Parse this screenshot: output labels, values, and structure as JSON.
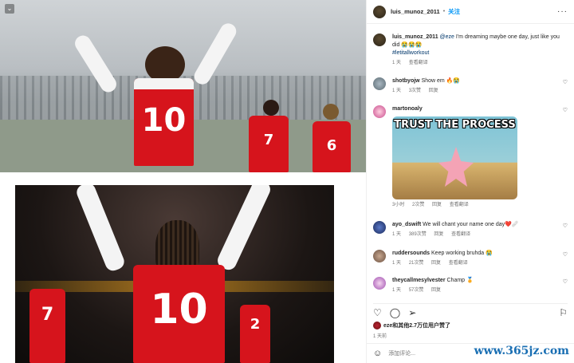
{
  "post": {
    "author": "luis_munoz_2011",
    "separator": "•",
    "follow_label": "关注",
    "more_label": "···",
    "caption_mention": "@eze",
    "caption_text": " I'm dreaming maybe one day, just like you did 😭😭😭",
    "hashtag": "#letitallworkout",
    "caption_time": "1 天",
    "caption_translate": "查看翻译"
  },
  "comments": [
    {
      "user": "shotbyojw",
      "text": "Show em 🔥😭",
      "time": "1 天",
      "likes": "3次赞",
      "reply": "回复"
    },
    {
      "user": "martonoaly",
      "text": "",
      "time": "3小时",
      "likes": "2次赞",
      "reply": "回复",
      "translate": "查看翻译",
      "meme_text": "TRUST THE PROCESS"
    },
    {
      "user": "ayo_dswift",
      "text": "We will chant your name one day❤️🩹",
      "time": "1 天",
      "likes": "389次赞",
      "reply": "回复",
      "translate": "查看翻译"
    },
    {
      "user": "ruddersounds",
      "text": "Keep working bruhda 😭",
      "time": "1 天",
      "likes": "21次赞",
      "reply": "回复",
      "translate": "查看翻译"
    },
    {
      "user": "theycallmesylvester",
      "text": "Champ 🏅",
      "time": "1 天",
      "likes": "57次赞",
      "reply": "回复"
    }
  ],
  "actions": {
    "like_icon": "heart-icon",
    "comment_icon": "comment-icon",
    "share_icon": "share-icon",
    "save_icon": "bookmark-icon"
  },
  "likes_text": "eze和其他2.7万位用户赞了",
  "post_age": "1 天前",
  "add_comment_placeholder": "添加评论...",
  "photos": {
    "top_number": "10",
    "bg_numbers": [
      "7",
      "6"
    ],
    "bottom_number": "10",
    "bottom_bg_numbers": [
      "7",
      "2"
    ]
  },
  "watermark": "www.365jz.com",
  "colors": {
    "accent": "#0095f6",
    "arsenal_red": "#d6141c"
  }
}
